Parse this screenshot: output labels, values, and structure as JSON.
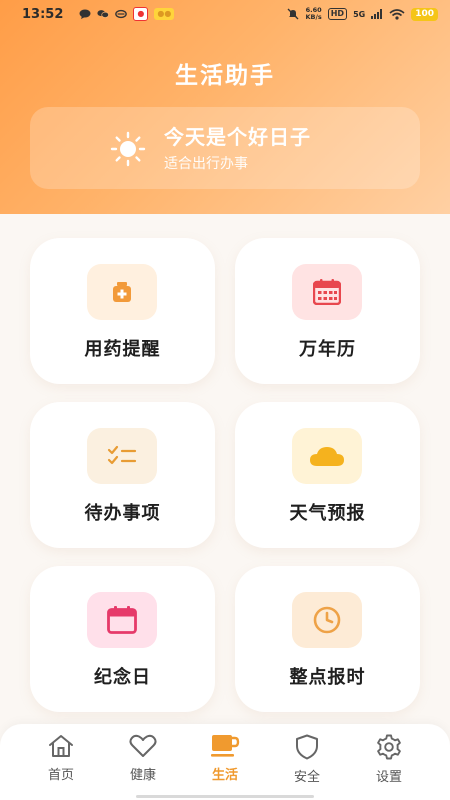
{
  "status_bar": {
    "time": "13:52",
    "net_speed_value": "6.60",
    "net_speed_unit": "KB/s",
    "hd": "HD",
    "signal": "5G",
    "battery": "100"
  },
  "header": {
    "title": "生活助手",
    "banner_title": "今天是个好日子",
    "banner_subtitle": "适合出行办事"
  },
  "cards": [
    {
      "label": "用药提醒",
      "icon": "medicine-box-icon",
      "bg": "#fff0df",
      "color": "#f29a3a"
    },
    {
      "label": "万年历",
      "icon": "calendar-icon",
      "bg": "#ffe3e3",
      "color": "#e8474e"
    },
    {
      "label": "待办事项",
      "icon": "todo-list-icon",
      "bg": "#fbf0e0",
      "color": "#e89c34"
    },
    {
      "label": "天气预报",
      "icon": "cloud-icon",
      "bg": "#fff3d6",
      "color": "#f5b21e"
    },
    {
      "label": "纪念日",
      "icon": "anniversary-calendar-icon",
      "bg": "#ffe0ea",
      "color": "#e63a6a"
    },
    {
      "label": "整点报时",
      "icon": "clock-icon",
      "bg": "#fdebd6",
      "color": "#eea247"
    }
  ],
  "tabs": [
    {
      "label": "首页",
      "icon": "home-icon"
    },
    {
      "label": "健康",
      "icon": "heart-icon"
    },
    {
      "label": "生活",
      "icon": "coffee-cup-icon",
      "active": true
    },
    {
      "label": "安全",
      "icon": "shield-icon"
    },
    {
      "label": "设置",
      "icon": "gear-icon"
    }
  ],
  "colors": {
    "accent": "#ff9d47",
    "tab_active": "#f09a2f",
    "tab_inactive": "#555555"
  }
}
